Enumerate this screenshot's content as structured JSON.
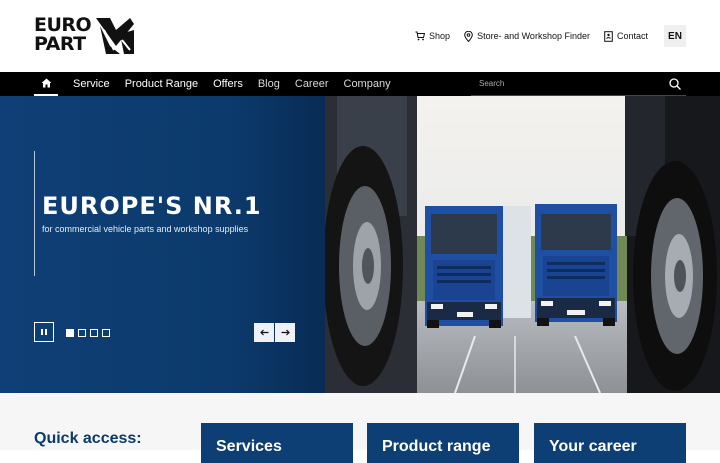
{
  "header": {
    "logo_line1": "EURO",
    "logo_line2": "PART",
    "links": {
      "shop": "Shop",
      "finder": "Store- and Workshop Finder",
      "contact": "Contact"
    },
    "language": "EN"
  },
  "nav": {
    "items": [
      "Service",
      "Product Range",
      "Offers",
      "Blog",
      "Career",
      "Company"
    ],
    "search_placeholder": "Search"
  },
  "hero": {
    "title": "EUROPE'S NR.1",
    "subtitle": "for commercial vehicle parts and workshop supplies",
    "slides_total": 4,
    "active_slide": 1
  },
  "quick_access": {
    "title": "Quick access:",
    "cards": [
      "Services",
      "Product range",
      "Your career"
    ]
  },
  "colors": {
    "brand_blue": "#0d3e74",
    "nav_bg": "#000000",
    "truck_blue": "#1f4fa3"
  }
}
